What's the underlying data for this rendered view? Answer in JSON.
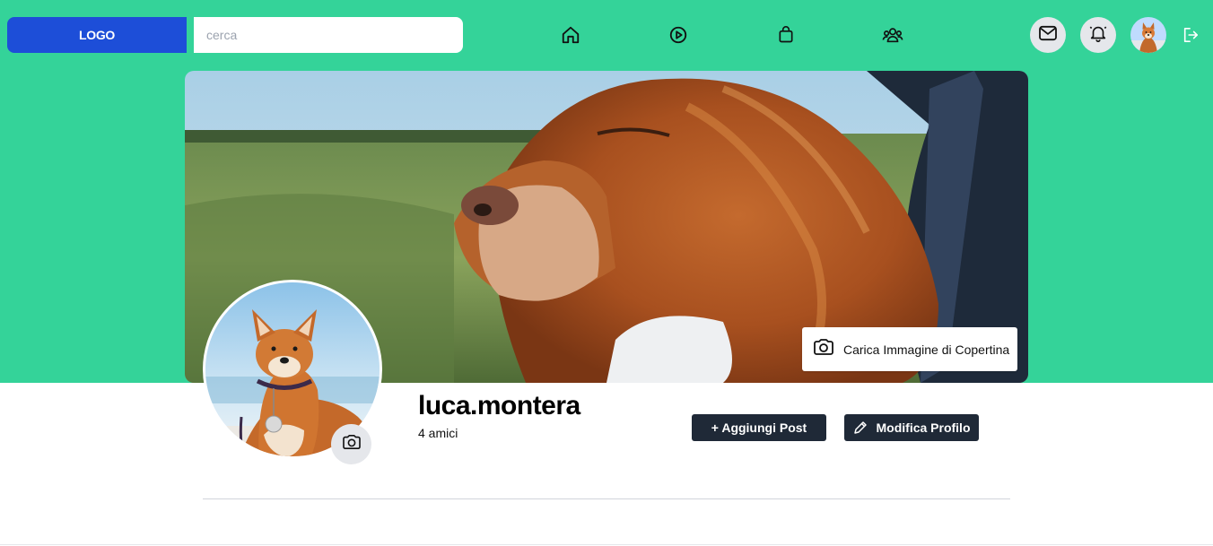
{
  "header": {
    "logo": "LOGO",
    "search_placeholder": "cerca",
    "nav": [
      "home-icon",
      "video-play-icon",
      "marketplace-bag-icon",
      "groups-icon"
    ],
    "actions": [
      "mail-icon",
      "bell-icon",
      "avatar",
      "logout-icon"
    ]
  },
  "cover": {
    "upload_label": "Carica Immagine di Copertina"
  },
  "profile": {
    "username": "luca.montera",
    "friends": "4 amici"
  },
  "buttons": {
    "add_post": "+ Aggiungi Post",
    "edit_profile": "Modifica Profilo"
  },
  "colors": {
    "accent": "#34d399",
    "logo_bg": "#1d4ed8",
    "dark_button": "#1f2937"
  }
}
